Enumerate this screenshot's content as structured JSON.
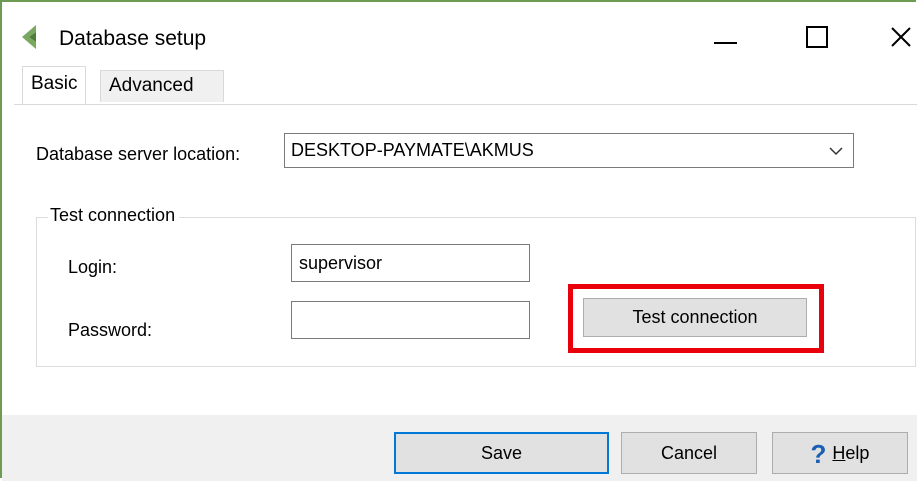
{
  "window": {
    "title": "Database setup",
    "icon": "leaf-chevron-icon",
    "accent_color": "#6e9b52"
  },
  "tabs": [
    {
      "label": "Basic",
      "selected": true
    },
    {
      "label": "Advanced",
      "selected": false
    }
  ],
  "server": {
    "label": "Database server location:",
    "value": "DESKTOP-PAYMATE\\AKMUS"
  },
  "test_connection": {
    "group_title": "Test connection",
    "login_label": "Login:",
    "login_value": "supervisor",
    "password_label": "Password:",
    "password_value": "",
    "button_label": "Test connection",
    "highlight_color": "#e8000b"
  },
  "footer": {
    "save_label": "Save",
    "cancel_label": "Cancel",
    "help_first": "H",
    "help_rest": "elp"
  }
}
